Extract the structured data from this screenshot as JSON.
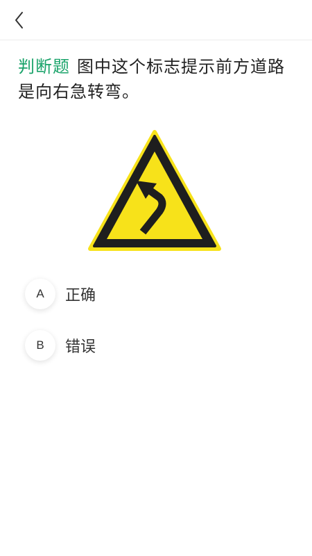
{
  "question": {
    "type_label": "判断题",
    "text": "图中这个标志提示前方道路是向右急转弯。"
  },
  "options": [
    {
      "letter": "A",
      "label": "正确"
    },
    {
      "letter": "B",
      "label": "错误"
    }
  ],
  "colors": {
    "accent_green": "#1aa36a",
    "sign_yellow": "#f7e21a",
    "sign_black": "#1e1e1e"
  },
  "icons": {
    "back": "chevron-left-icon",
    "sign": "reverse-curve-warning-sign"
  }
}
